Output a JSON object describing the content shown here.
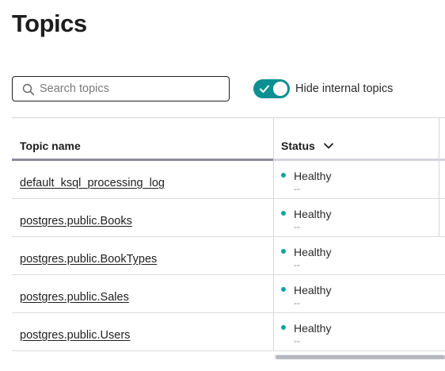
{
  "page": {
    "title": "Topics"
  },
  "search": {
    "placeholder": "Search topics",
    "value": ""
  },
  "toggle": {
    "label": "Hide internal topics",
    "checked": true,
    "color": "#0e8f91"
  },
  "table": {
    "columns": [
      {
        "label": "Topic name"
      },
      {
        "label": "Status",
        "sort_icon": "chevron-down-icon"
      }
    ],
    "rows": [
      {
        "name": "default_ksql_processing_log",
        "status": "Healthy",
        "status_sub": "--"
      },
      {
        "name": "postgres.public.Books",
        "status": "Healthy",
        "status_sub": "--"
      },
      {
        "name": "postgres.public.BookTypes",
        "status": "Healthy",
        "status_sub": "--"
      },
      {
        "name": "postgres.public.Sales",
        "status": "Healthy",
        "status_sub": "--"
      },
      {
        "name": "postgres.public.Users",
        "status": "Healthy",
        "status_sub": "--"
      }
    ],
    "status_color": "#11a3a0"
  }
}
